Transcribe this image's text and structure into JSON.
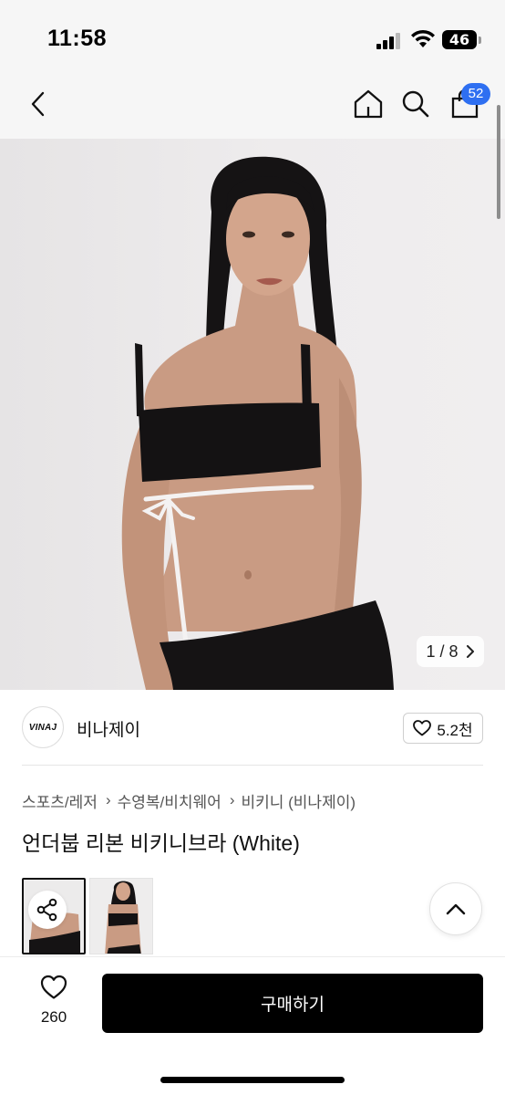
{
  "status_bar": {
    "time": "11:58",
    "battery": "46"
  },
  "nav": {
    "back_icon": "chevron-left-icon",
    "home_icon": "home-icon",
    "search_icon": "search-icon",
    "bag_icon": "shopping-bag-icon",
    "bag_count": "52",
    "badge_color": "#2e6ff1"
  },
  "image": {
    "counter": "1 / 8",
    "current": 1,
    "total": 8
  },
  "shop": {
    "logo_text": "VINAJ",
    "name": "비나제이",
    "like_icon": "heart-outline-icon",
    "like_count": "5.2천"
  },
  "breadcrumb": [
    "스포츠/레저",
    "수영복/비치웨어",
    "비키니 (비나제이)"
  ],
  "product": {
    "title": "언더붑 리본 비키니브라 (White)"
  },
  "actions": {
    "share_icon": "share-icon",
    "scroll_top_icon": "chevron-up-icon",
    "wish_icon": "heart-outline-icon",
    "wish_count": "260",
    "buy_label": "구매하기"
  }
}
